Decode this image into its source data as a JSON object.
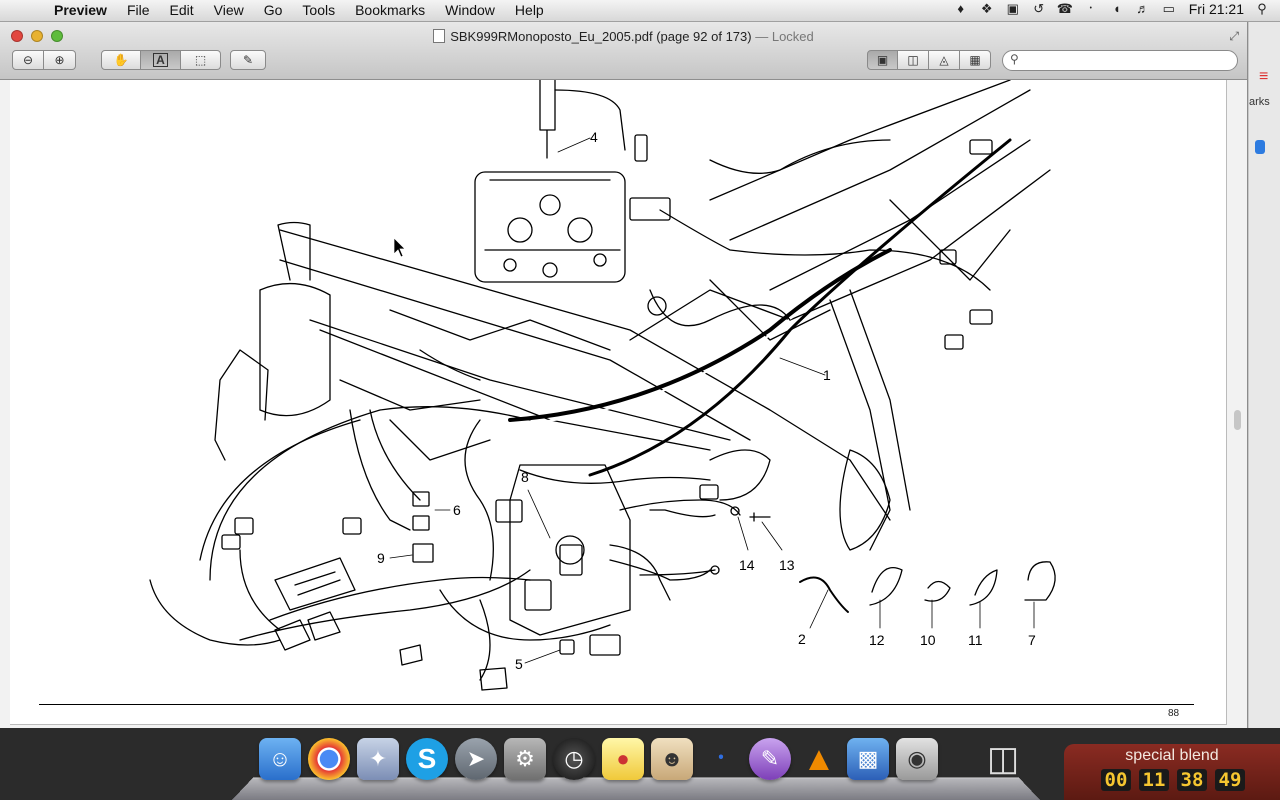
{
  "menubar": {
    "app_name": "Preview",
    "menus": [
      "File",
      "Edit",
      "View",
      "Go",
      "Tools",
      "Bookmarks",
      "Window",
      "Help"
    ],
    "clock": "Fri 21:21",
    "status_icons": [
      "notification-icon",
      "dropbox-icon",
      "evernote-icon",
      "time-machine-icon",
      "phone-icon",
      "bluetooth-icon",
      "wifi-icon",
      "volume-icon",
      "battery-icon",
      "spotlight-icon"
    ]
  },
  "window": {
    "title_file": "SBK999RMonoposto_Eu_2005.pdf (page 92 of 173)",
    "title_status": "— Locked",
    "search_placeholder": ""
  },
  "document": {
    "callouts": [
      "1",
      "2",
      "4",
      "5",
      "6",
      "7",
      "8",
      "9",
      "10",
      "11",
      "12",
      "13",
      "14"
    ],
    "page_number": "88"
  },
  "desktop_strip_text": "arks",
  "dock": {
    "apps": [
      "Finder",
      "Google Chrome",
      "Preview",
      "Skype",
      "Launchpad",
      "System Preferences",
      "Dashboard",
      "Toolbox",
      "Photo Booth",
      "Bluetooth File Exchange",
      "Script Editor",
      "VLC",
      "Keynote",
      "Preview Alt",
      "Trash"
    ]
  },
  "widget": {
    "title": "special blend",
    "digits": [
      "00",
      "11",
      "38",
      "49"
    ]
  },
  "colors": {
    "widget_bg": "#7a241b",
    "widget_digits": "#f6c630",
    "menubar_bg": "#e6e6e6"
  }
}
